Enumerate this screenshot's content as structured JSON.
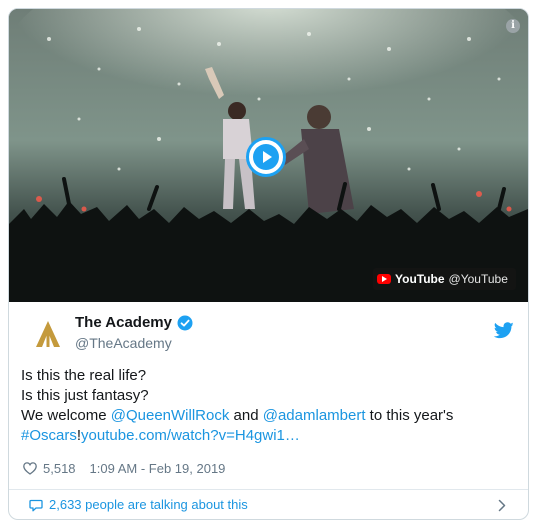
{
  "media": {
    "source_name": "YouTube",
    "source_handle": "@YouTube",
    "info_glyph": "i"
  },
  "author": {
    "display_name": "The Academy",
    "handle": "@TheAcademy"
  },
  "tweet": {
    "line1": "Is this the real life?",
    "line2": "Is this just fantasy?",
    "line3_pre": "We welcome ",
    "mention1": "@QueenWillRock",
    "line3_mid": " and ",
    "mention2": "@adamlambert",
    "line3_post": " to this year's",
    "hashtag": "#Oscars",
    "line4_mid": "!",
    "url": "youtube.com/watch?v=H4gwi1…"
  },
  "stats": {
    "likes": "5,518",
    "timestamp": "1:09 AM - Feb 19, 2019"
  },
  "footer": {
    "talking": "2,633 people are talking about this"
  },
  "colors": {
    "link": "#1b95e0",
    "twitter_blue": "#1da1f2",
    "gold": "#c49a3c"
  }
}
